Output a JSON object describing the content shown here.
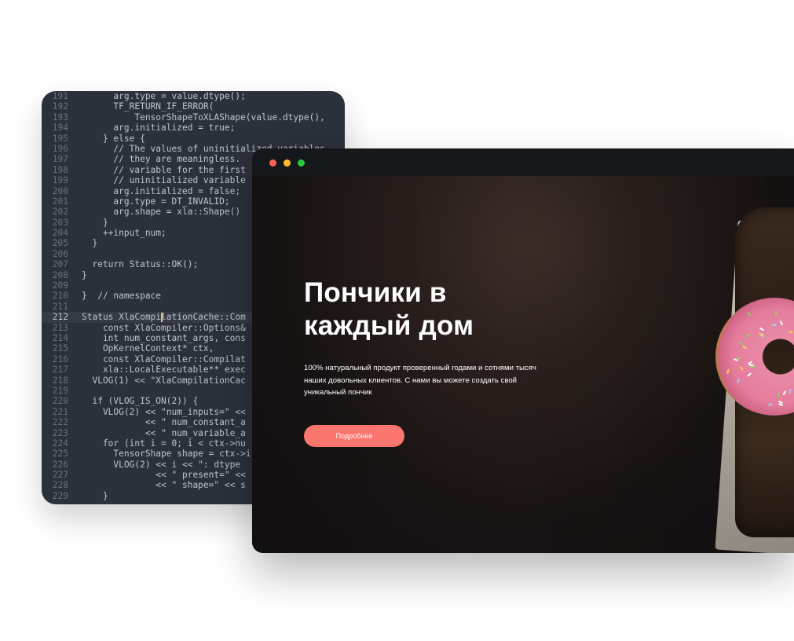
{
  "code_editor": {
    "lines": [
      {
        "num": "191",
        "text": "      arg.type = value.dtype();"
      },
      {
        "num": "192",
        "text": "      TF_RETURN_IF_ERROR("
      },
      {
        "num": "193",
        "text": "          TensorShapeToXLAShape(value.dtype(),"
      },
      {
        "num": "194",
        "text": "      arg.initialized = true;"
      },
      {
        "num": "195",
        "text": "    } else {"
      },
      {
        "num": "196",
        "text": "      // The values of uninitialized variables"
      },
      {
        "num": "197",
        "text": "      // they are meaningless."
      },
      {
        "num": "198",
        "text": "      // variable for the first"
      },
      {
        "num": "199",
        "text": "      // uninitialized variable"
      },
      {
        "num": "200",
        "text": "      arg.initialized = false;"
      },
      {
        "num": "201",
        "text": "      arg.type = DT_INVALID;"
      },
      {
        "num": "202",
        "text": "      arg.shape = xla::Shape()"
      },
      {
        "num": "203",
        "text": "    }"
      },
      {
        "num": "204",
        "text": "    ++input_num;"
      },
      {
        "num": "205",
        "text": "  }"
      },
      {
        "num": "206",
        "text": ""
      },
      {
        "num": "207",
        "text": "  return Status::OK();"
      },
      {
        "num": "208",
        "text": "}"
      },
      {
        "num": "209",
        "text": ""
      },
      {
        "num": "210",
        "text": "}  // namespace"
      },
      {
        "num": "211",
        "text": ""
      },
      {
        "num": "212",
        "text": "Status XlaCompilationCache::Com"
      },
      {
        "num": "213",
        "text": "    const XlaCompiler::Options&"
      },
      {
        "num": "214",
        "text": "    int num_constant_args, cons"
      },
      {
        "num": "215",
        "text": "    OpKernelContext* ctx,"
      },
      {
        "num": "216",
        "text": "    const XlaCompiler::Compilat"
      },
      {
        "num": "217",
        "text": "    xla::LocalExecutable** exec"
      },
      {
        "num": "218",
        "text": "  VLOG(1) << \"XlaCompilationCac"
      },
      {
        "num": "219",
        "text": ""
      },
      {
        "num": "220",
        "text": "  if (VLOG_IS_ON(2)) {"
      },
      {
        "num": "221",
        "text": "    VLOG(2) << \"num_inputs=\" <<"
      },
      {
        "num": "222",
        "text": "            << \" num_constant_a"
      },
      {
        "num": "223",
        "text": "            << \" num_variable_a"
      },
      {
        "num": "224",
        "text": "    for (int i = 0; i < ctx->nu"
      },
      {
        "num": "225",
        "text": "      TensorShape shape = ctx->i"
      },
      {
        "num": "226",
        "text": "      VLOG(2) << i << \": dtype"
      },
      {
        "num": "227",
        "text": "              << \" present=\" <<"
      },
      {
        "num": "228",
        "text": "              << \" shape=\" << s"
      },
      {
        "num": "229",
        "text": "    }"
      }
    ]
  },
  "browser": {
    "window_dots": [
      "close",
      "minimize",
      "maximize"
    ],
    "colors": {
      "close": "#fc5f57",
      "minimize": "#fdbd2f",
      "maximize": "#28c840",
      "accent_button": "#fb766e",
      "hero_bg": "#1a1414"
    }
  },
  "hero": {
    "title_line1": "Пончики в",
    "title_line2": "каждый дом",
    "description_line1": "100% натуральный продукт проверенный годами и сотнями тысяч",
    "description_line2": "наших довольных клиентов. С нами вы можете создать свой",
    "description_line3": "уникальный пончик",
    "cta_label": "Подробнее"
  }
}
